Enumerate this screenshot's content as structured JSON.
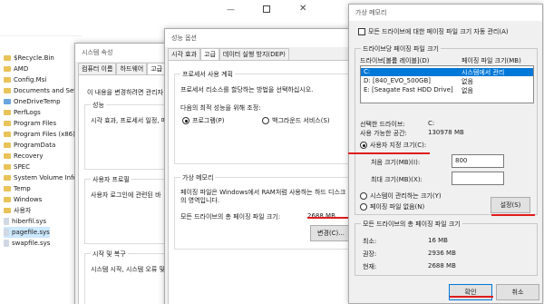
{
  "explorer": {
    "items": [
      {
        "label": "$Recycle.Bin",
        "type": "folder"
      },
      {
        "label": "AMD",
        "type": "folder"
      },
      {
        "label": "Config.Msi",
        "type": "folder"
      },
      {
        "label": "Documents and Settin",
        "type": "folder"
      },
      {
        "label": "OneDriveTemp",
        "type": "folder"
      },
      {
        "label": "PerfLogs",
        "type": "folder"
      },
      {
        "label": "Program Files",
        "type": "folder"
      },
      {
        "label": "Program Files (x86)",
        "type": "folder"
      },
      {
        "label": "ProgramData",
        "type": "folder"
      },
      {
        "label": "Recovery",
        "type": "folder"
      },
      {
        "label": "SPEC",
        "type": "folder"
      },
      {
        "label": "System Volume Inform",
        "type": "folder"
      },
      {
        "label": "Temp",
        "type": "folder"
      },
      {
        "label": "Windows",
        "type": "folder"
      },
      {
        "label": "사용자",
        "type": "folder"
      },
      {
        "label": "hiberfil.sys",
        "type": "file"
      },
      {
        "label": "pagefile.sys",
        "type": "file"
      },
      {
        "label": "swapfile.sys",
        "type": "file"
      }
    ]
  },
  "sysprops": {
    "title": "시스템 속성",
    "tabs": [
      "컴퓨터 이름",
      "하드웨어",
      "고급"
    ],
    "intro": "이 내용을 변경하려면 관리자",
    "perf_label": "성능",
    "perf_text": "시각 효과, 프로세서 일정, 메",
    "profile_label": "사용자 프로필",
    "profile_text": "사용자 로그인에 관련된 바",
    "startup_label": "시작 및 복구",
    "startup_text": "시스템 시작, 시스템 오류 및"
  },
  "perfopts": {
    "title": "성능 옵션",
    "tabs": [
      "시각 효과",
      "고급",
      "데이터 실행 방지(DEP)"
    ],
    "sched_label": "프로세서 사용 계획",
    "sched_text": "프로세서 리소스를 할당하는 방법을 선택하십시오.",
    "optimize_text": "다음의 최적 성능을 위해 조정:",
    "radio_programs": "프로그램(P)",
    "radio_services": "백그라운드 서비스(S)",
    "vm_label": "가상 메모리",
    "vm_text1": "페이징 파일은 Windows에서 RAM처럼 사용하는 하드 디스크",
    "vm_text2": "의 영역입니다.",
    "vm_total_label": "모든 드라이브의 총 페이징 파일 크기:",
    "vm_total_value": "2688 MB",
    "change_button": "변경(C)..."
  },
  "vmem": {
    "title": "가상 메모리",
    "auto_manage": "모든 드라이브에 대한 페이징 파일 크기 자동 관리(A)",
    "per_drive_label": "드라이브당 페이징 파일 크기",
    "col_drive": "드라이브[볼륨 레이블](D)",
    "col_size": "페이징 파일 크기(MB)",
    "drives": [
      {
        "drive": "C:",
        "size": "시스템에서 관리"
      },
      {
        "drive": "D:      [840_EVO_500GB]",
        "size": "없음"
      },
      {
        "drive": "E:      [Seagate Fast HDD Drive]",
        "size": "없음"
      }
    ],
    "selected_drive_label": "선택한 드라이브:",
    "selected_drive_value": "C:",
    "space_label": "사용 가능한 공간:",
    "space_value": "130978 MB",
    "custom_size": "사용자 지정 크기(C):",
    "initial_label": "처음 크기(MB)(I):",
    "initial_value": "800",
    "max_label": "최대 크기(MB)(X):",
    "max_value": "",
    "system_managed": "시스템이 관리하는 크기(Y)",
    "no_paging": "페이징 파일 없음(N)",
    "set_button": "설정(S)",
    "total_label": "모든 드라이브의 총 페이징 파일 크기",
    "min_label": "최소:",
    "min_value": "16 MB",
    "rec_label": "권장:",
    "rec_value": "2936 MB",
    "cur_label": "현재:",
    "cur_value": "2688 MB",
    "ok_button": "확인",
    "cancel_button": "취소"
  },
  "colors": {
    "selection": "#0078d7",
    "annotation": "#e01c1c"
  }
}
